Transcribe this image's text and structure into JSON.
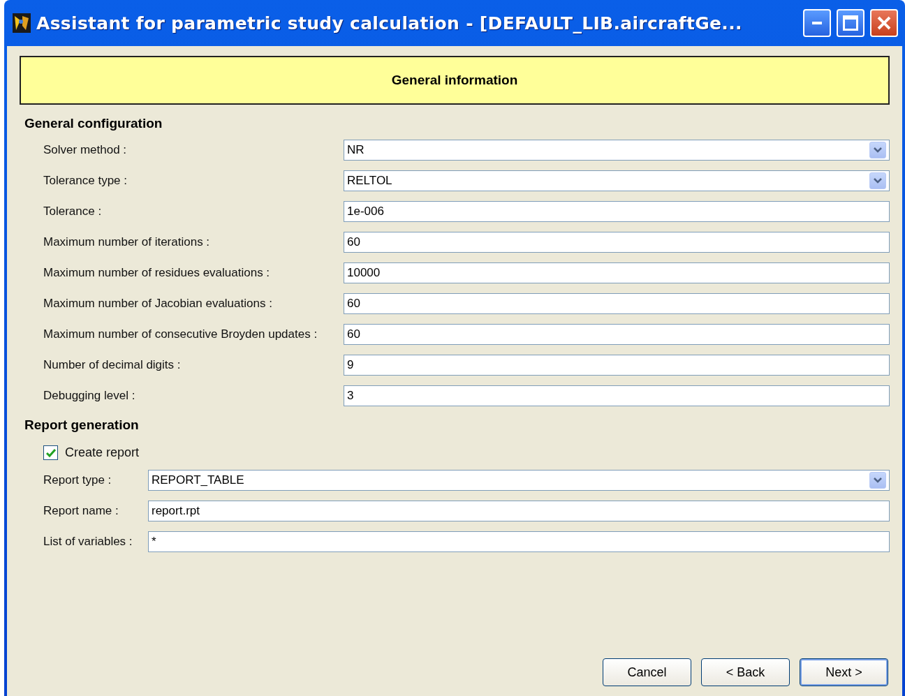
{
  "window": {
    "title": "Assistant for parametric study calculation - [DEFAULT_LIB.aircraftGe..."
  },
  "header": {
    "title": "General information"
  },
  "general": {
    "title": "General configuration",
    "fields": [
      {
        "label": "Solver method :",
        "kind": "combo",
        "value": "NR"
      },
      {
        "label": "Tolerance type :",
        "kind": "combo",
        "value": "RELTOL"
      },
      {
        "label": "Tolerance :",
        "kind": "text",
        "value": "1e-006"
      },
      {
        "label": "Maximum number of iterations :",
        "kind": "text",
        "value": "60"
      },
      {
        "label": "Maximum number of residues evaluations :",
        "kind": "text",
        "value": "10000"
      },
      {
        "label": "Maximum number of Jacobian evaluations :",
        "kind": "text",
        "value": "60"
      },
      {
        "label": "Maximum number of consecutive Broyden updates :",
        "kind": "text",
        "value": "60"
      },
      {
        "label": "Number of decimal digits :",
        "kind": "text",
        "value": "9"
      },
      {
        "label": "Debugging level :",
        "kind": "text",
        "value": "3"
      }
    ]
  },
  "report": {
    "title": "Report generation",
    "create_report": {
      "label": "Create report",
      "checked": true
    },
    "fields": [
      {
        "label": "Report type :",
        "kind": "combo",
        "value": "REPORT_TABLE"
      },
      {
        "label": "Report name :",
        "kind": "text",
        "value": "report.rpt"
      },
      {
        "label": "List of variables :",
        "kind": "text",
        "value": "*"
      }
    ]
  },
  "buttons": [
    {
      "label": "Cancel",
      "default": false
    },
    {
      "label": "< Back",
      "default": false
    },
    {
      "label": "Next >",
      "default": true
    }
  ]
}
